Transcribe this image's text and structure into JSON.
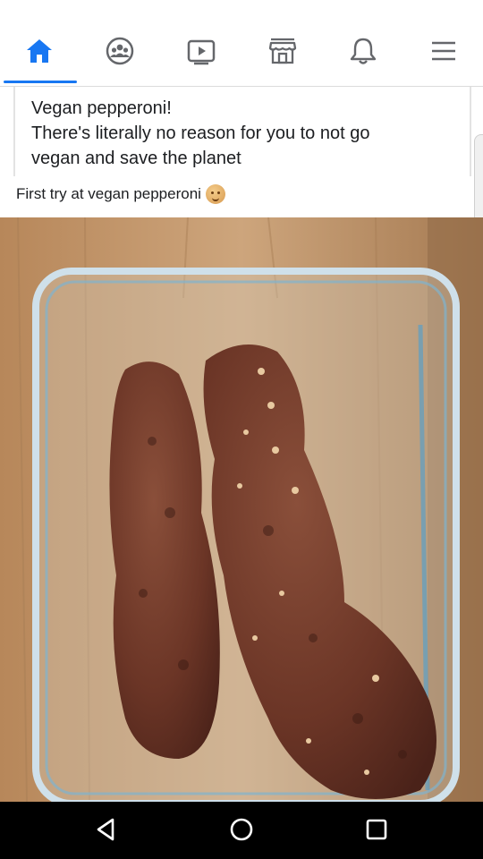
{
  "nav": {
    "items": [
      {
        "icon": "home-icon",
        "active": true
      },
      {
        "icon": "groups-icon",
        "active": false
      },
      {
        "icon": "watch-icon",
        "active": false
      },
      {
        "icon": "marketplace-icon",
        "active": false
      },
      {
        "icon": "notifications-icon",
        "active": false
      },
      {
        "icon": "menu-icon",
        "active": false
      }
    ],
    "accent_color": "#1877f2",
    "icon_color": "#65676b"
  },
  "post": {
    "lines": [
      "Vegan pepperoni!",
      "There's literally no reason for you to not go",
      "vegan and save the planet"
    ],
    "caption": "First try at vegan pepperoni",
    "caption_emoji": "grinning-face-emoji"
  },
  "photo": {
    "subject": "photo-of-sausages-in-glass-container"
  },
  "system_nav": {
    "buttons": [
      "back-icon",
      "home-circle-icon",
      "recents-icon"
    ]
  }
}
